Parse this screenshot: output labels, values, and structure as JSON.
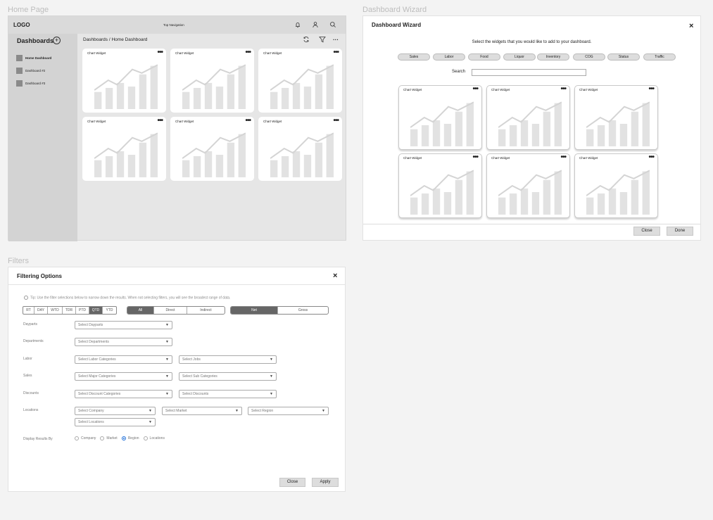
{
  "frames": {
    "home": "Home Page",
    "wizard": "Dashboard Wizard",
    "filters": "Filters"
  },
  "home": {
    "logo": "LOGO",
    "top_nav": "Top Navigation",
    "sidebar_title": "Dashboards",
    "sidebar_items": [
      "Home Dashboard",
      "Dashboard #2",
      "Dashboard #3"
    ],
    "breadcrumb": "Dashboards / Home Dashboard",
    "widgets": [
      "Chart Widget",
      "Chart Widget",
      "Chart Widget",
      "Chart Widget",
      "Chart Widget",
      "Chart Widget"
    ],
    "more": "•••"
  },
  "wizard": {
    "title": "Dashboard Wizard",
    "subtitle": "Select the widgets that you would like to add to your dashboard.",
    "categories": [
      "Sales",
      "Labor",
      "Food",
      "Liquor",
      "Inventory",
      "COG",
      "Status",
      "Traffic"
    ],
    "search_label": "Search",
    "widgets": [
      "Chart Widget",
      "Chart Widget",
      "Chart Widget",
      "Chart Widget",
      "Chart Widget",
      "Chart Widget"
    ],
    "close": "Close",
    "done": "Done"
  },
  "filters": {
    "title": "Filtering Options",
    "tip": "Tip: Use the filter selections below to narrow down the results. When not selecting filters, you will see the broadest range of data.",
    "periods": [
      "RT",
      "DAY",
      "WTD",
      "TDR",
      "PTD",
      "QTD",
      "YTD"
    ],
    "period_selected": "QTD",
    "types": [
      "All",
      "Direct",
      "Indirect"
    ],
    "type_selected": "All",
    "net_gross": [
      "Net",
      "Gross"
    ],
    "net_gross_selected": "Net",
    "labels": {
      "dayparts": "Dayparts",
      "departments": "Departments",
      "labor": "Labor",
      "sales": "Sales",
      "discounts": "Discounts",
      "locations": "Locations",
      "display": "Display Results By"
    },
    "selects": {
      "dayparts": "Select Dayparts",
      "departments": "Select Departments",
      "labor_categories": "Select Labor Categories",
      "jobs": "Select Jobs",
      "major_categories": "Select Major Categories",
      "sub_categories": "Select Sub Categories",
      "discount_categories": "Select Discount Categories",
      "discounts": "Select Discounts",
      "company": "Select Company",
      "market": "Select Market",
      "region": "Select Region",
      "locations": "Select Locations"
    },
    "display_options": [
      "Company",
      "Market",
      "Region",
      "Locations"
    ],
    "display_selected": "Region",
    "close": "Close",
    "apply": "Apply"
  }
}
